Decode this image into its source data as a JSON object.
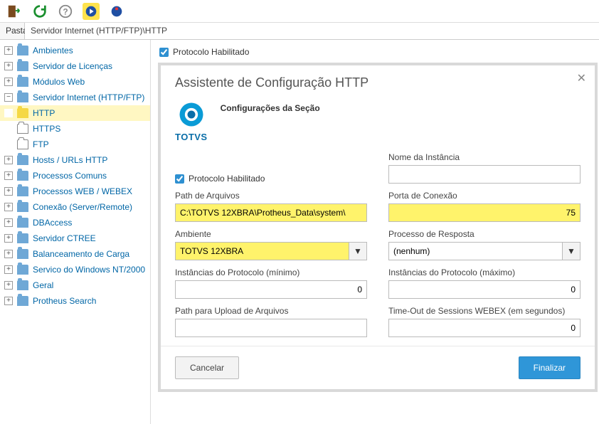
{
  "toolbar": {
    "icons": [
      "exit",
      "refresh",
      "help",
      "wizard",
      "dist"
    ]
  },
  "breadcrumb": {
    "label": "Pasta",
    "path": "Servidor Internet (HTTP/FTP)\\HTTP"
  },
  "tree": {
    "items": [
      {
        "label": "Ambientes",
        "expandable": true
      },
      {
        "label": "Servidor de Licenças",
        "expandable": true
      },
      {
        "label": "Módulos Web",
        "expandable": true
      },
      {
        "label": "Servidor Internet (HTTP/FTP)",
        "expandable": true,
        "expanded": true,
        "children": [
          {
            "label": "HTTP",
            "selected": true
          },
          {
            "label": "HTTPS"
          },
          {
            "label": "FTP"
          }
        ]
      },
      {
        "label": "Hosts / URLs HTTP",
        "expandable": true
      },
      {
        "label": "Processos Comuns",
        "expandable": true
      },
      {
        "label": "Processos WEB / WEBEX",
        "expandable": true
      },
      {
        "label": "Conexão (Server/Remote)",
        "expandable": true
      },
      {
        "label": "DBAccess",
        "expandable": true
      },
      {
        "label": "Servidor CTREE",
        "expandable": true
      },
      {
        "label": "Balanceamento de Carga",
        "expandable": true
      },
      {
        "label": "Servico do Windows NT/2000",
        "expandable": true
      },
      {
        "label": "Geral",
        "expandable": true
      },
      {
        "label": "Protheus Search",
        "expandable": true
      }
    ]
  },
  "page": {
    "protocol_enabled_label": "Protocolo Habilitado"
  },
  "wizard": {
    "title": "Assistente de Configuração  HTTP",
    "logo_text": "TOTVS",
    "section_title": "Configurações da Seção",
    "fields": {
      "protocol_enabled": {
        "label": "Protocolo Habilitado",
        "checked": true
      },
      "instance_name": {
        "label": "Nome da Instância",
        "value": ""
      },
      "files_path": {
        "label": "Path de Arquivos",
        "value": "C:\\TOTVS 12XBRA\\Protheus_Data\\system\\"
      },
      "connection_port": {
        "label": "Porta de Conexão",
        "value": "75"
      },
      "environment": {
        "label": "Ambiente",
        "value": "TOTVS 12XBRA"
      },
      "response_process": {
        "label": "Processo de Resposta",
        "value": "(nenhum)"
      },
      "instances_min": {
        "label": "Instâncias do Protocolo (mínimo)",
        "value": "0"
      },
      "instances_max": {
        "label": "Instâncias do Protocolo (máximo)",
        "value": "0"
      },
      "upload_path": {
        "label": "Path para Upload de Arquivos",
        "value": ""
      },
      "webex_timeout": {
        "label": "Time-Out de Sessions WEBEX (em segundos)",
        "value": "0"
      }
    },
    "buttons": {
      "cancel": "Cancelar",
      "finish": "Finalizar"
    }
  }
}
